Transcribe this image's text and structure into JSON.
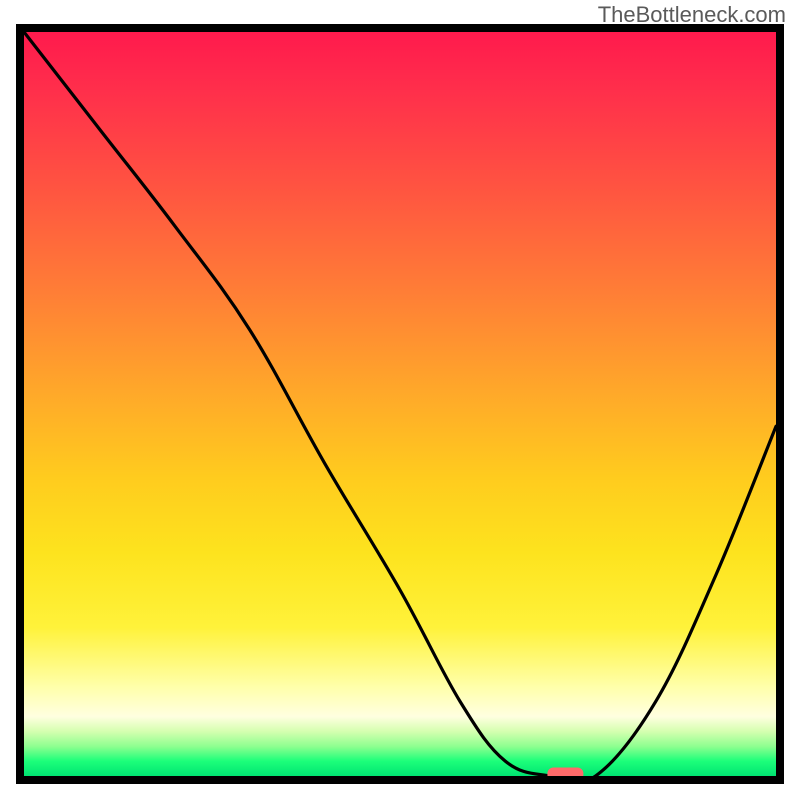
{
  "watermark": "TheBottleneck.com",
  "chart_data": {
    "type": "line",
    "title": "",
    "xlabel": "",
    "ylabel": "",
    "xlim": [
      0,
      100
    ],
    "ylim": [
      0,
      100
    ],
    "x": [
      0,
      10,
      20,
      30,
      40,
      50,
      58,
      64,
      70,
      76,
      84,
      92,
      100
    ],
    "values": [
      100,
      87,
      74,
      60,
      42,
      25,
      10,
      2,
      0,
      0,
      10,
      27,
      47
    ],
    "marker": {
      "x": 72,
      "y": 0,
      "color": "#ff6a6a"
    },
    "grid": false,
    "background_gradient": {
      "top": "#ff1a4d",
      "bottom": "#00e472"
    }
  }
}
